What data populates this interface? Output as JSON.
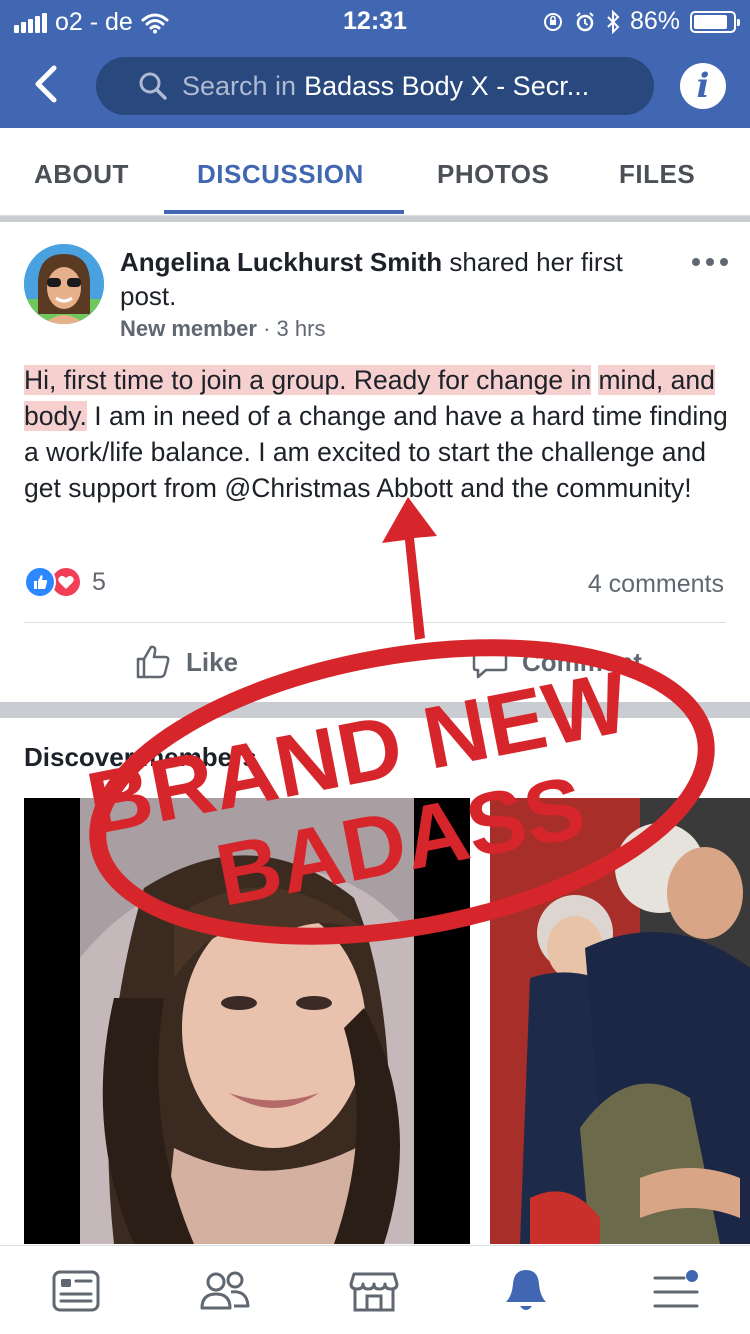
{
  "status_bar": {
    "carrier": "o2 - de",
    "time": "12:31",
    "battery_percent": "86%",
    "battery_level": 0.86
  },
  "header": {
    "search_placeholder": "Search in",
    "group_name": "Badass Body X - Secr..."
  },
  "tabs": [
    {
      "label": "ABOUT",
      "active": false
    },
    {
      "label": "DISCUSSION",
      "active": true
    },
    {
      "label": "PHOTOS",
      "active": false
    },
    {
      "label": "FILES",
      "active": false
    }
  ],
  "post": {
    "author": "Angelina Luckhurst Smith",
    "action": "shared her first post.",
    "badge": "New member",
    "separator": "·",
    "time": "3 hrs",
    "text_highlighted_1": "Hi, first time to join a group.  Ready for change in",
    "text_highlighted_2": "mind, and body.",
    "text_rest": " I am in need of a change and have a hard time finding a work/life balance.  I am excited to start the challenge and get support from @Christmas Abbott and the community!",
    "reaction_count": "5",
    "comments": "4 comments",
    "like_label": "Like",
    "comment_label": "Comment"
  },
  "discover": {
    "title": "Discover members"
  },
  "overlay": {
    "line1": "BRAND NEW",
    "line2": "BADASS",
    "color": "#d7262b"
  },
  "colors": {
    "brand": "#4267b2",
    "highlight": "#f6d0cf"
  }
}
